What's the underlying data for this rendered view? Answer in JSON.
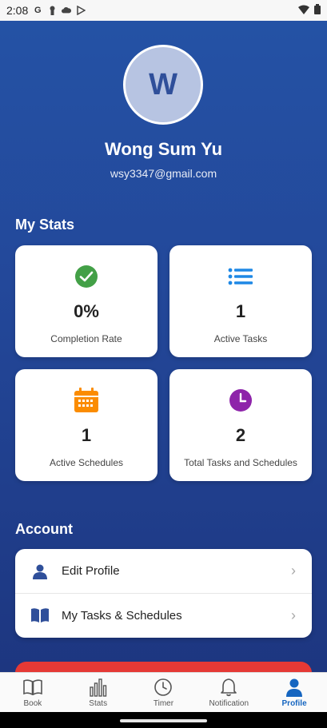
{
  "status": {
    "time": "2:08"
  },
  "profile": {
    "initial": "W",
    "name": "Wong Sum Yu",
    "email": "wsy3347@gmail.com"
  },
  "stats": {
    "title": "My Stats",
    "cards": [
      {
        "value": "0%",
        "label": "Completion Rate",
        "icon": "check-circle-icon",
        "color": "#43a047"
      },
      {
        "value": "1",
        "label": "Active Tasks",
        "icon": "list-icon",
        "color": "#1e88e5"
      },
      {
        "value": "1",
        "label": "Active Schedules",
        "icon": "calendar-icon",
        "color": "#fb8c00"
      },
      {
        "value": "2",
        "label": "Total Tasks and Schedules",
        "icon": "clock-icon",
        "color": "#8e24aa"
      }
    ]
  },
  "account": {
    "title": "Account",
    "items": [
      {
        "label": "Edit Profile",
        "icon": "person-icon"
      },
      {
        "label": "My Tasks & Schedules",
        "icon": "book-icon"
      }
    ]
  },
  "nav": {
    "items": [
      {
        "label": "Book",
        "icon": "book-icon"
      },
      {
        "label": "Stats",
        "icon": "bar-chart-icon"
      },
      {
        "label": "Timer",
        "icon": "clock-icon"
      },
      {
        "label": "Notification",
        "icon": "bell-icon"
      },
      {
        "label": "Profile",
        "icon": "person-icon",
        "active": true
      }
    ],
    "active_color": "#1565c0"
  }
}
